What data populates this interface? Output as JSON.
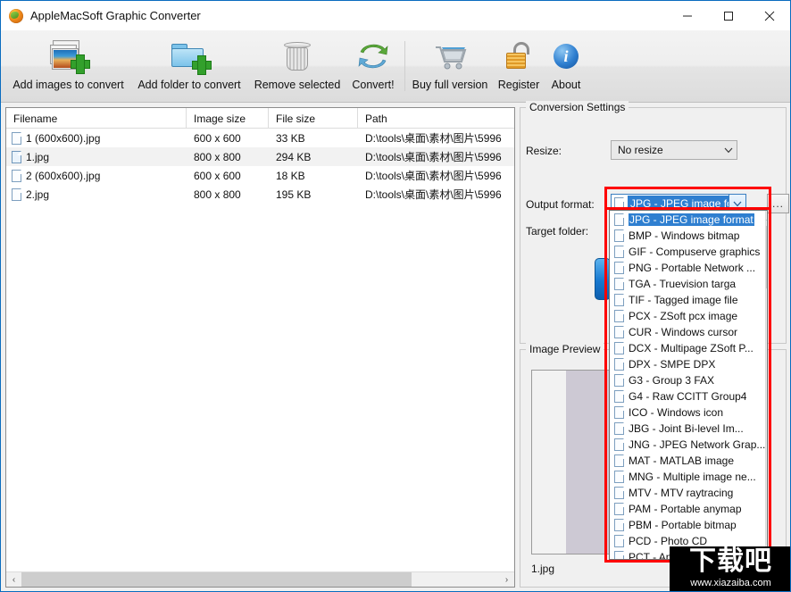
{
  "window": {
    "title": "AppleMacSoft Graphic Converter",
    "app_icon": "globe-icon",
    "minimize_label": "Minimize",
    "maximize_label": "Maximize",
    "close_label": "Close"
  },
  "toolbar": {
    "items": [
      {
        "label": "Add images to convert",
        "icon": "add-images-icon"
      },
      {
        "label": "Add folder to convert",
        "icon": "add-folder-icon"
      },
      {
        "label": "Remove selected",
        "icon": "trash-icon"
      },
      {
        "label": "Convert!",
        "icon": "convert-arrows-icon"
      },
      {
        "label": "Buy full version",
        "icon": "shopping-cart-icon"
      },
      {
        "label": "Register",
        "icon": "unlocked-padlock-icon"
      },
      {
        "label": "About",
        "icon": "info-icon"
      }
    ]
  },
  "filelist": {
    "columns": [
      "Filename",
      "Image size",
      "File size",
      "Path"
    ],
    "rows": [
      {
        "filename": "1 (600x600).jpg",
        "image_size": "600 x 600",
        "file_size": "33 KB",
        "path": "D:\\tools\\桌面\\素材\\图片\\5996",
        "selected": false
      },
      {
        "filename": "1.jpg",
        "image_size": "800 x 800",
        "file_size": "294 KB",
        "path": "D:\\tools\\桌面\\素材\\图片\\5996",
        "selected": true
      },
      {
        "filename": "2 (600x600).jpg",
        "image_size": "600 x 600",
        "file_size": "18 KB",
        "path": "D:\\tools\\桌面\\素材\\图片\\5996",
        "selected": false
      },
      {
        "filename": "2.jpg",
        "image_size": "800 x 800",
        "file_size": "195 KB",
        "path": "D:\\tools\\桌面\\素材\\图片\\5996",
        "selected": false
      }
    ],
    "scroll_left_label": "‹",
    "scroll_right_label": "›"
  },
  "settings": {
    "group_title": "Conversion Settings",
    "resize_label": "Resize:",
    "resize_value": "No resize",
    "output_format_label": "Output format:",
    "output_format_value": "JPG - JPEG image format",
    "browse_label": "...",
    "target_folder_label": "Target folder:"
  },
  "dropdown": {
    "selected_index": 0,
    "options": [
      "JPG - JPEG image format",
      "BMP - Windows bitmap",
      "GIF - Compuserve graphics",
      "PNG - Portable Network ...",
      "TGA - Truevision targa",
      "TIF - Tagged image file",
      "PCX - ZSoft pcx image",
      "CUR - Windows cursor",
      "DCX - Multipage ZSoft P...",
      "DPX - SMPE DPX",
      "G3 - Group 3 FAX",
      "G4 - Raw CCITT Group4",
      "ICO - Windows icon",
      "JBG - Joint Bi-level Im...",
      "JNG - JPEG Network Grap...",
      "MAT - MATLAB image",
      "MNG - Multiple image ne...",
      "MTV - MTV raytracing",
      "PAM - Portable anymap",
      "PBM - Portable bitmap",
      "PCD - Photo CD",
      "PCT - Ap"
    ],
    "scroll_up_label": "⌃"
  },
  "preview": {
    "group_title": "Image Preview",
    "filename": "1.jpg"
  },
  "watermark": {
    "text_cn": "下载吧",
    "url": "www.xiazaiba.com"
  },
  "colors": {
    "accent": "#2f7fd0",
    "highlight_box": "#ff0000",
    "window_border": "#0a6cbf",
    "toolbar_bg": "#e8e8e8"
  }
}
